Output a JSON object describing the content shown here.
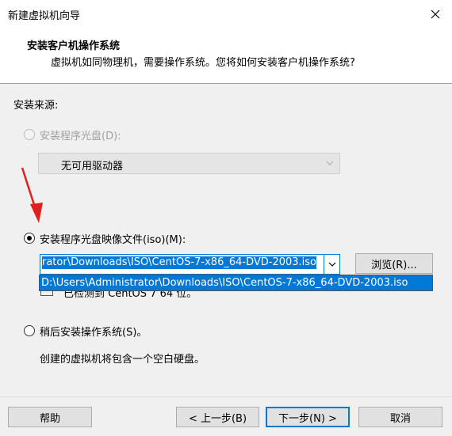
{
  "window": {
    "title": "新建虚拟机向导"
  },
  "header": {
    "title": "安装客户机操作系统",
    "description": "虚拟机如同物理机，需要操作系统。您将如何安装客户机操作系统?"
  },
  "install_source": {
    "label": "安装来源:",
    "options": [
      {
        "label": "安装程序光盘(D):",
        "selected": false,
        "enabled": false
      },
      {
        "label": "安装程序光盘映像文件(iso)(M):",
        "selected": true,
        "enabled": true
      },
      {
        "label": "稍后安装操作系统(S)。",
        "selected": false,
        "enabled": true
      }
    ],
    "disc_combo_value": "无可用驱动器",
    "iso_combo_value": "rator\\Downloads\\ISO\\CentOS-7-x86_64-DVD-2003.iso",
    "iso_dropdown_item": "D:\\Users\\Administrator\\Downloads\\ISO\\CentOS-7-x86_64-DVD-2003.iso",
    "browse_label": "浏览(R)...",
    "detected_text": "已检测到 CentOS 7 64 位。",
    "later_description": "创建的虚拟机将包含一个空白硬盘。"
  },
  "buttons": {
    "help": "帮助",
    "back": "< 上一步(B)",
    "next": "下一步(N) >",
    "cancel": "取消"
  },
  "colors": {
    "accent": "#0078d7",
    "annotation_arrow": "#e02020"
  }
}
